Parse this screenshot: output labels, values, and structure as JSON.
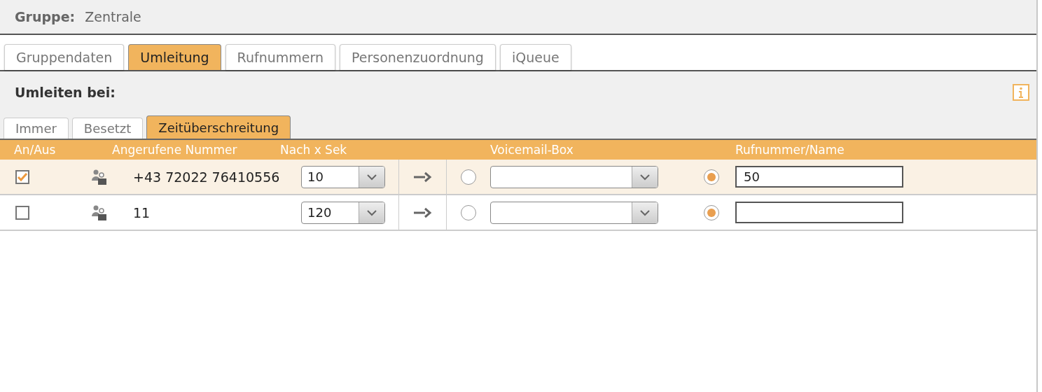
{
  "group": {
    "label": "Gruppe:",
    "value": "Zentrale"
  },
  "tabs": [
    {
      "label": "Gruppendaten",
      "selected": false
    },
    {
      "label": "Umleitung",
      "selected": true
    },
    {
      "label": "Rufnummern",
      "selected": false
    },
    {
      "label": "Personenzuordnung",
      "selected": false
    },
    {
      "label": "iQueue",
      "selected": false
    }
  ],
  "section_title": "Umleiten bei:",
  "subtabs": [
    {
      "label": "Immer",
      "selected": false
    },
    {
      "label": "Besetzt",
      "selected": false
    },
    {
      "label": "Zeitüberschreitung",
      "selected": true
    }
  ],
  "table": {
    "columns": [
      "An/Aus",
      "Angerufene Nummer",
      "Nach x Sek",
      "Voicemail-Box",
      "Rufnummer/Name"
    ],
    "rows": [
      {
        "selected": true,
        "checked": true,
        "number": "+43 72022 76410556",
        "delay": "10",
        "voicemail_selected": false,
        "target_selected": true,
        "target": "50"
      },
      {
        "selected": false,
        "checked": false,
        "number": "11",
        "delay": "120",
        "voicemail_selected": false,
        "target_selected": true
      }
    ]
  }
}
